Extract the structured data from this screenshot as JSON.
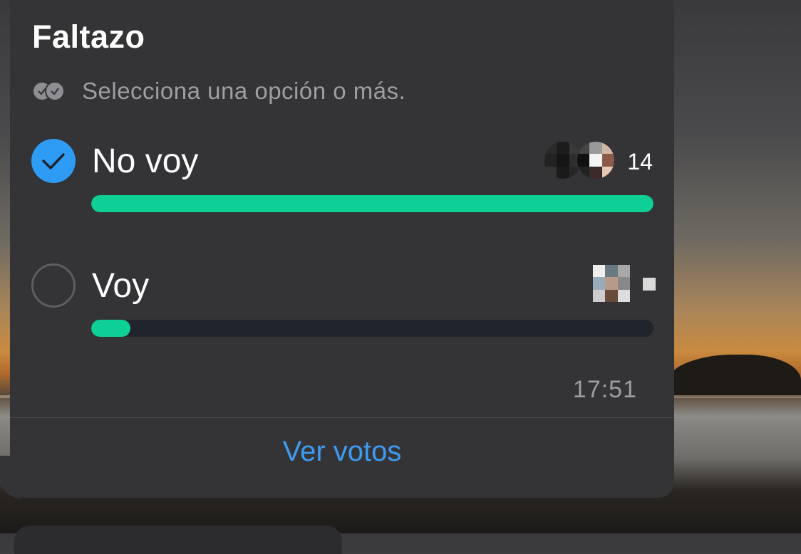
{
  "poll": {
    "title": "Faltazo",
    "hint": "Selecciona una opción o más.",
    "options": [
      {
        "label": "No voy",
        "votes": "14",
        "selected": true,
        "fraction": 1.0
      },
      {
        "label": "Voy",
        "votes": "",
        "selected": false,
        "fraction": 0.07
      }
    ],
    "time": "17:51",
    "view_votes": "Ver votos"
  },
  "colors": {
    "accent": "#2e9cf5",
    "bar_fill": "#0ecf96",
    "bubble": "#343437",
    "link": "#3d9bf0"
  },
  "icons": {
    "multi_check": "double-check-icon",
    "selected": "checkmark-icon"
  }
}
